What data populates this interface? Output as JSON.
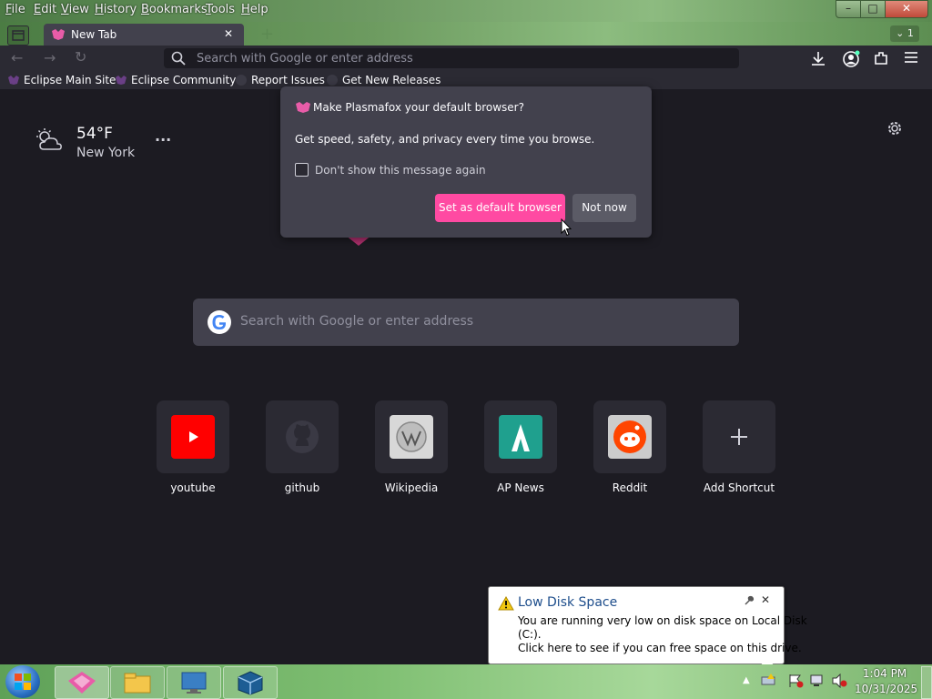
{
  "menu": [
    "File",
    "Edit",
    "View",
    "History",
    "Bookmarks",
    "Tools",
    "Help"
  ],
  "window_controls": {
    "minimize": "–",
    "maximize": "□",
    "close": "✕"
  },
  "tab": {
    "title": "New Tab",
    "close": "✕",
    "new_tab": "+",
    "tab_count": "1"
  },
  "urlbar": {
    "placeholder": "Search with Google or enter address"
  },
  "bookmarks": [
    "Eclipse Main Site",
    "Eclipse Community",
    "Report Issues",
    "Get New Releases"
  ],
  "weather": {
    "temp": "54°F",
    "city": "New York",
    "more": "···"
  },
  "search": {
    "placeholder": "Search with Google or enter address"
  },
  "shortcuts": [
    {
      "label": "youtube",
      "icon": "youtube-icon",
      "color": "#ff0000"
    },
    {
      "label": "github",
      "icon": "github-icon",
      "color": "#3a3944"
    },
    {
      "label": "Wikipedia",
      "icon": "wikipedia-icon",
      "color": "#d8d8d8"
    },
    {
      "label": "AP News",
      "icon": "apnews-icon",
      "color": "#1fa08e"
    },
    {
      "label": "Reddit",
      "icon": "reddit-icon",
      "color": "#ff4500"
    },
    {
      "label": "Add Shortcut",
      "icon": "plus-icon",
      "color": "#2b2a33"
    }
  ],
  "dialog": {
    "title": "Make Plasmafox your default browser?",
    "body": "Get speed, safety, and privacy every time you browse.",
    "checkbox_label": "Don't show this message again",
    "primary_button": "Set as default browser",
    "secondary_button": "Not now"
  },
  "notification": {
    "title": "Low Disk Space",
    "line1": "You are running very low on disk space on Local Disk",
    "line2": "(C:).",
    "line3": "Click here to see if you can free space on this drive.",
    "close": "✕"
  },
  "clock": {
    "time": "1:04 PM",
    "date": "10/31/2025"
  },
  "colors": {
    "accent": "#ff4aa2",
    "dialog_bg": "#42414d",
    "page_bg": "#1c1b22",
    "taskbar": "#7fbf72"
  }
}
